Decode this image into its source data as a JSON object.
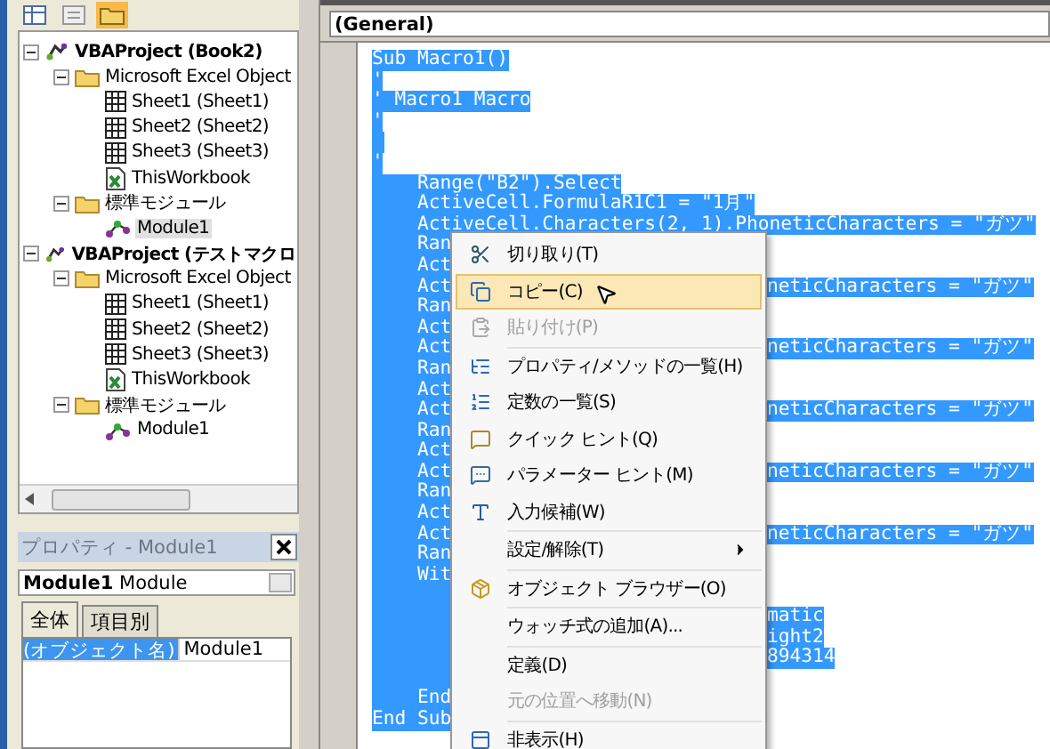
{
  "explorer": {
    "tree": [
      {
        "label": "VBAProject (Book2)",
        "kind": "project",
        "expanded": true,
        "selected": false,
        "children": [
          {
            "label": "Microsoft Excel Object",
            "kind": "folder",
            "expanded": true,
            "selected": false,
            "children": [
              {
                "label": "Sheet1 (Sheet1)",
                "kind": "sheet",
                "selected": false
              },
              {
                "label": "Sheet2 (Sheet2)",
                "kind": "sheet",
                "selected": false
              },
              {
                "label": "Sheet3 (Sheet3)",
                "kind": "sheet",
                "selected": false
              },
              {
                "label": "ThisWorkbook",
                "kind": "workbook",
                "selected": false
              }
            ]
          },
          {
            "label": "標準モジュール",
            "kind": "folder",
            "expanded": true,
            "selected": false,
            "children": [
              {
                "label": "Module1",
                "kind": "module",
                "selected": true
              }
            ]
          }
        ]
      },
      {
        "label": "VBAProject (テストマクロ",
        "kind": "project",
        "expanded": true,
        "selected": false,
        "children": [
          {
            "label": "Microsoft Excel Object",
            "kind": "folder",
            "expanded": true,
            "selected": false,
            "children": [
              {
                "label": "Sheet1 (Sheet1)",
                "kind": "sheet",
                "selected": false
              },
              {
                "label": "Sheet2 (Sheet2)",
                "kind": "sheet",
                "selected": false
              },
              {
                "label": "Sheet3 (Sheet3)",
                "kind": "sheet",
                "selected": false
              },
              {
                "label": "ThisWorkbook",
                "kind": "workbook",
                "selected": false
              }
            ]
          },
          {
            "label": "標準モジュール",
            "kind": "folder",
            "expanded": true,
            "selected": false,
            "children": [
              {
                "label": "Module1",
                "kind": "module",
                "selected": false
              }
            ]
          }
        ]
      }
    ]
  },
  "properties": {
    "title": "プロパティ - Module1",
    "object": {
      "name": "Module1",
      "type": "Module"
    },
    "tabs": [
      {
        "label": "全体",
        "selected": true
      },
      {
        "label": "項目別",
        "selected": false
      }
    ],
    "rows": [
      {
        "name": "(オブジェクト名)",
        "value": "Module1",
        "selected": true
      }
    ]
  },
  "code": {
    "procedure": "(General)",
    "selected": true,
    "lines": [
      {
        "text": "Sub Macro1()"
      },
      {
        "text": "'"
      },
      {
        "text": "' Macro1 Macro"
      },
      {
        "text": "'"
      },
      {
        "blank": true
      },
      {
        "text": "'"
      },
      {
        "text": "    Range(\"B2\").Select"
      },
      {
        "text": "    ActiveCell.FormulaR1C1 = \"1月\""
      },
      {
        "text": "    ActiveCell.Characters(2, 1).PhoneticCharacters = \"ガツ\""
      },
      {
        "text": "    Ran",
        "cut": true
      },
      {
        "text": "    Act",
        "cut": true
      },
      {
        "text": "    Act",
        "cut": true,
        "after": "neticCharacters = \"ガツ\""
      },
      {
        "text": "    Ran",
        "cut": true
      },
      {
        "text": "    Act",
        "cut": true
      },
      {
        "text": "    Act",
        "cut": true,
        "after": "neticCharacters = \"ガツ\""
      },
      {
        "text": "    Ran",
        "cut": true
      },
      {
        "text": "    Act",
        "cut": true
      },
      {
        "text": "    Act",
        "cut": true,
        "after": "neticCharacters = \"ガツ\""
      },
      {
        "text": "    Ran",
        "cut": true
      },
      {
        "text": "    Act",
        "cut": true
      },
      {
        "text": "    Act",
        "cut": true,
        "after": "neticCharacters = \"ガツ\""
      },
      {
        "text": "    Ran",
        "cut": true
      },
      {
        "text": "    Act",
        "cut": true
      },
      {
        "text": "    Act",
        "cut": true,
        "after": "neticCharacters = \"ガツ\""
      },
      {
        "text": "    Ran",
        "cut": true
      },
      {
        "text": "    Wit",
        "cut": true
      },
      {
        "blank": true,
        "cut": true
      },
      {
        "blank": true,
        "cut": true,
        "after": "matic"
      },
      {
        "blank": true,
        "cut": true,
        "after": "ight2"
      },
      {
        "blank": true,
        "cut": true,
        "after": "894314"
      },
      {
        "blank": true,
        "cut": true
      },
      {
        "text": "    End",
        "cut": true
      },
      {
        "text": "End Sub",
        "cut": true
      }
    ]
  },
  "context_menu": [
    {
      "kind": "item",
      "label": "切り取り(T)",
      "selected": false,
      "disabled": false
    },
    {
      "kind": "item",
      "label": "コピー(C)",
      "selected": true,
      "disabled": false
    },
    {
      "kind": "item",
      "label": "貼り付け(P)",
      "selected": false,
      "disabled": true
    },
    {
      "kind": "separator"
    },
    {
      "kind": "item",
      "label": "プロパティ/メソッドの一覧(H)",
      "selected": false,
      "disabled": false
    },
    {
      "kind": "item",
      "label": "定数の一覧(S)",
      "selected": false,
      "disabled": false
    },
    {
      "kind": "item",
      "label": "クイック ヒント(Q)",
      "selected": false,
      "disabled": false
    },
    {
      "kind": "item",
      "label": "パラメーター ヒント(M)",
      "selected": false,
      "disabled": false
    },
    {
      "kind": "item",
      "label": "入力候補(W)",
      "selected": false,
      "disabled": false
    },
    {
      "kind": "separator"
    },
    {
      "kind": "item",
      "label": "設定/解除(T)",
      "selected": false,
      "disabled": false,
      "submenu": true
    },
    {
      "kind": "separator"
    },
    {
      "kind": "item",
      "label": "オブジェクト ブラウザー(O)",
      "selected": false,
      "disabled": false
    },
    {
      "kind": "separator"
    },
    {
      "kind": "item",
      "label": "ウォッチ式の追加(A)...",
      "selected": false,
      "disabled": false
    },
    {
      "kind": "separator"
    },
    {
      "kind": "item",
      "label": "定義(D)",
      "selected": false,
      "disabled": false
    },
    {
      "kind": "item",
      "label": "元の位置へ移動(N)",
      "selected": false,
      "disabled": true
    },
    {
      "kind": "separator"
    },
    {
      "kind": "item",
      "label": "非表示(H)",
      "selected": false,
      "disabled": false
    }
  ]
}
